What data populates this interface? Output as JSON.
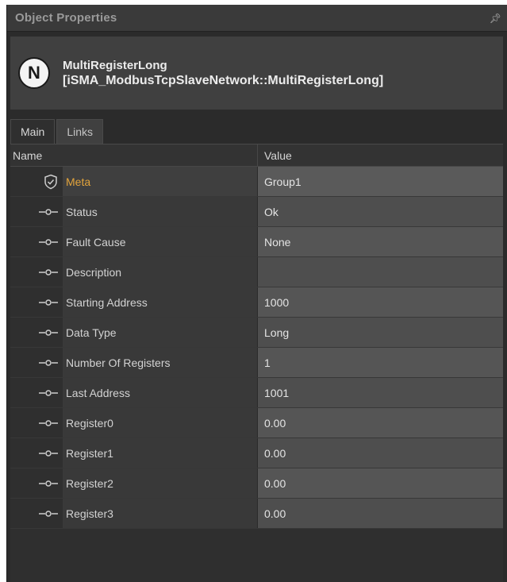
{
  "panel": {
    "title": "Object Properties",
    "pin_icon": "pin-icon"
  },
  "header": {
    "badge_letter": "N",
    "name": "MultiRegisterLong",
    "type": "[iSMA_ModbusTcpSlaveNetwork::MultiRegisterLong]"
  },
  "tabs": [
    {
      "label": "Main",
      "active": true
    },
    {
      "label": "Links",
      "active": false
    }
  ],
  "grid": {
    "columns": {
      "name": "Name",
      "value": "Value"
    },
    "rows": [
      {
        "icon": "shield-icon",
        "name": "Meta",
        "value": "Group1"
      },
      {
        "icon": "slot-icon",
        "name": "Status",
        "value": "Ok"
      },
      {
        "icon": "slot-icon",
        "name": "Fault Cause",
        "value": "None"
      },
      {
        "icon": "slot-icon",
        "name": "Description",
        "value": ""
      },
      {
        "icon": "slot-icon",
        "name": "Starting Address",
        "value": "1000"
      },
      {
        "icon": "slot-icon",
        "name": "Data Type",
        "value": "Long"
      },
      {
        "icon": "slot-icon",
        "name": "Number Of Registers",
        "value": "1"
      },
      {
        "icon": "slot-icon",
        "name": "Last Address",
        "value": "1001"
      },
      {
        "icon": "slot-icon",
        "name": "Register0",
        "value": "0.00"
      },
      {
        "icon": "slot-icon",
        "name": "Register1",
        "value": "0.00"
      },
      {
        "icon": "slot-icon",
        "name": "Register2",
        "value": "0.00"
      },
      {
        "icon": "slot-icon",
        "name": "Register3",
        "value": "0.00"
      }
    ]
  },
  "colors": {
    "meta_label": "#e3a43c",
    "panel_bg": "#2b2b2b",
    "value_bg": "#555555"
  }
}
